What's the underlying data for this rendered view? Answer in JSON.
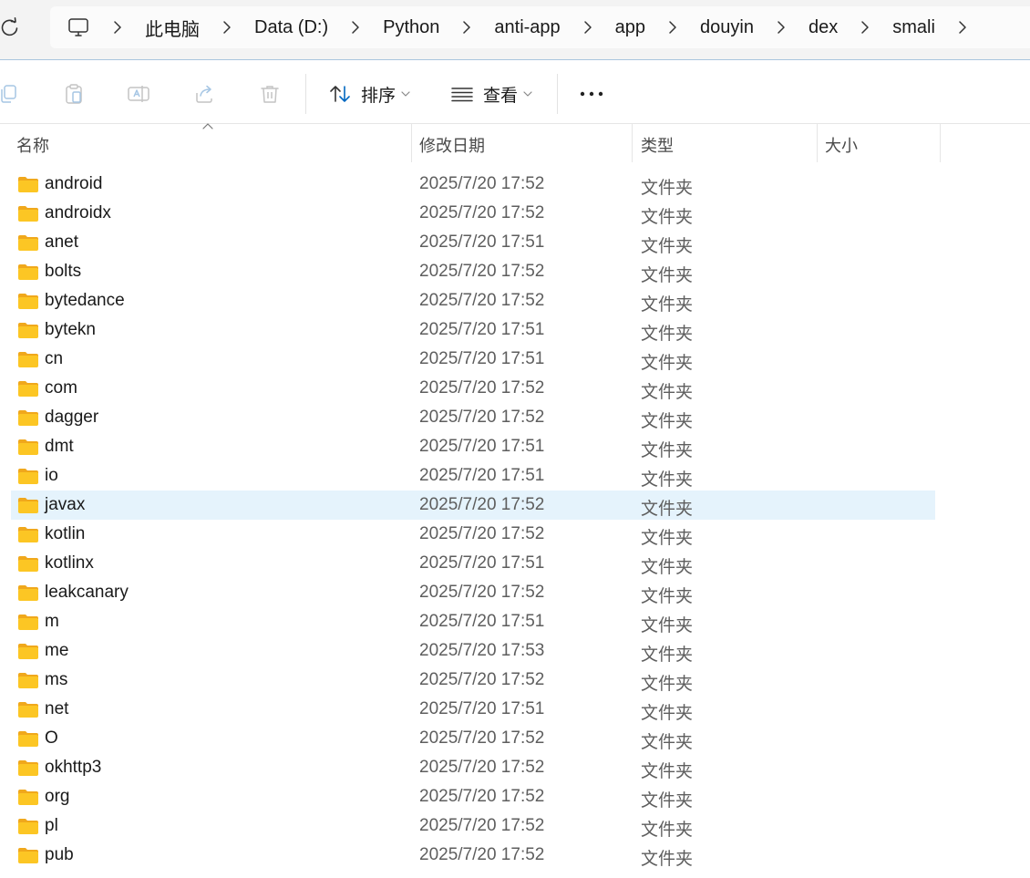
{
  "breadcrumb": {
    "items": [
      "此电脑",
      "Data (D:)",
      "Python",
      "anti-app",
      "app",
      "douyin",
      "dex",
      "smali"
    ]
  },
  "toolbar": {
    "sort_label": "排序",
    "view_label": "查看"
  },
  "columns": {
    "name": "名称",
    "date": "修改日期",
    "type": "类型",
    "size": "大小"
  },
  "files": [
    {
      "name": "android",
      "date": "2025/7/20 17:52",
      "type": "文件夹",
      "size": ""
    },
    {
      "name": "androidx",
      "date": "2025/7/20 17:52",
      "type": "文件夹",
      "size": ""
    },
    {
      "name": "anet",
      "date": "2025/7/20 17:51",
      "type": "文件夹",
      "size": ""
    },
    {
      "name": "bolts",
      "date": "2025/7/20 17:52",
      "type": "文件夹",
      "size": ""
    },
    {
      "name": "bytedance",
      "date": "2025/7/20 17:52",
      "type": "文件夹",
      "size": ""
    },
    {
      "name": "bytekn",
      "date": "2025/7/20 17:51",
      "type": "文件夹",
      "size": ""
    },
    {
      "name": "cn",
      "date": "2025/7/20 17:51",
      "type": "文件夹",
      "size": ""
    },
    {
      "name": "com",
      "date": "2025/7/20 17:52",
      "type": "文件夹",
      "size": ""
    },
    {
      "name": "dagger",
      "date": "2025/7/20 17:52",
      "type": "文件夹",
      "size": ""
    },
    {
      "name": "dmt",
      "date": "2025/7/20 17:51",
      "type": "文件夹",
      "size": ""
    },
    {
      "name": "io",
      "date": "2025/7/20 17:51",
      "type": "文件夹",
      "size": ""
    },
    {
      "name": "javax",
      "date": "2025/7/20 17:52",
      "type": "文件夹",
      "size": "",
      "selected": true
    },
    {
      "name": "kotlin",
      "date": "2025/7/20 17:52",
      "type": "文件夹",
      "size": ""
    },
    {
      "name": "kotlinx",
      "date": "2025/7/20 17:51",
      "type": "文件夹",
      "size": ""
    },
    {
      "name": "leakcanary",
      "date": "2025/7/20 17:52",
      "type": "文件夹",
      "size": ""
    },
    {
      "name": "m",
      "date": "2025/7/20 17:51",
      "type": "文件夹",
      "size": ""
    },
    {
      "name": "me",
      "date": "2025/7/20 17:53",
      "type": "文件夹",
      "size": ""
    },
    {
      "name": "ms",
      "date": "2025/7/20 17:52",
      "type": "文件夹",
      "size": ""
    },
    {
      "name": "net",
      "date": "2025/7/20 17:51",
      "type": "文件夹",
      "size": ""
    },
    {
      "name": "O",
      "date": "2025/7/20 17:52",
      "type": "文件夹",
      "size": ""
    },
    {
      "name": "okhttp3",
      "date": "2025/7/20 17:52",
      "type": "文件夹",
      "size": ""
    },
    {
      "name": "org",
      "date": "2025/7/20 17:52",
      "type": "文件夹",
      "size": ""
    },
    {
      "name": "pl",
      "date": "2025/7/20 17:52",
      "type": "文件夹",
      "size": ""
    },
    {
      "name": "pub",
      "date": "2025/7/20 17:52",
      "type": "文件夹",
      "size": ""
    }
  ],
  "colors": {
    "selected_row": "#e5f3fc",
    "folder_fill": "#fcc624",
    "folder_back": "#f0a81c",
    "accent": "#0067c0"
  },
  "icons": {
    "refresh": "refresh-icon",
    "computer": "computer-icon",
    "chevron": "chevron-right-icon",
    "copy": "copy-icon",
    "paste": "paste-icon",
    "rename": "rename-icon",
    "share": "share-icon",
    "delete": "delete-icon",
    "sort": "sort-icon",
    "view": "view-icon",
    "more": "more-icon",
    "folder": "folder-icon"
  }
}
